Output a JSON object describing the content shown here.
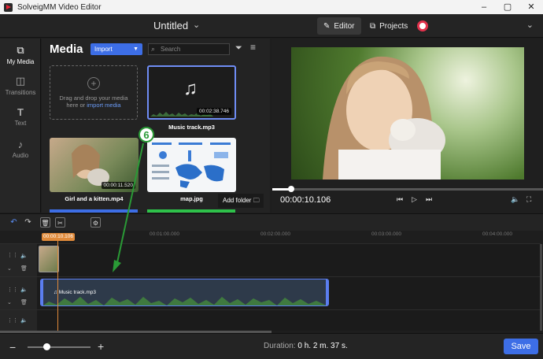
{
  "window": {
    "app_title": "SolveigMM Video Editor",
    "controls": [
      "–",
      "▢",
      "✕"
    ]
  },
  "appbar": {
    "doc_title": "Untitled",
    "editor_label": "Editor",
    "projects_label": "Projects"
  },
  "nav": [
    {
      "label": "My Media",
      "icon": "media-icon"
    },
    {
      "label": "Transitions",
      "icon": "transitions-icon"
    },
    {
      "label": "Text",
      "icon": "text-icon"
    },
    {
      "label": "Audio",
      "icon": "audio-icon"
    }
  ],
  "media": {
    "title": "Media",
    "import_label": "Import",
    "search_placeholder": "Search",
    "drop_text_1": "Drag and drop your media",
    "drop_text_2": "here or",
    "drop_link": "import media",
    "items": [
      {
        "name": "Music track.mp3",
        "duration": "00:02:38.746"
      },
      {
        "name": "Girl and a kitten.mp4",
        "duration": "00:00:11.520"
      },
      {
        "name": "map.jpg"
      }
    ],
    "add_folder_label": "Add folder"
  },
  "preview": {
    "timecode": "00:00:10.106",
    "progress": 0.07
  },
  "timeline": {
    "cursor_time": "00:00:10.106",
    "ticks": [
      "00:01:00.000",
      "00:02:00.000",
      "00:03:00.000",
      "00:04:00.000"
    ],
    "audio_clip_label": "Music track.mp3"
  },
  "status": {
    "duration_label": "Duration:",
    "duration_value": "0 h. 2 m. 37 s.",
    "save_label": "Save"
  },
  "annotation": {
    "step_number": "6"
  },
  "colors": {
    "accent": "#3d6ee6",
    "playhead": "#e08a3a",
    "callout": "#2a9a36"
  }
}
